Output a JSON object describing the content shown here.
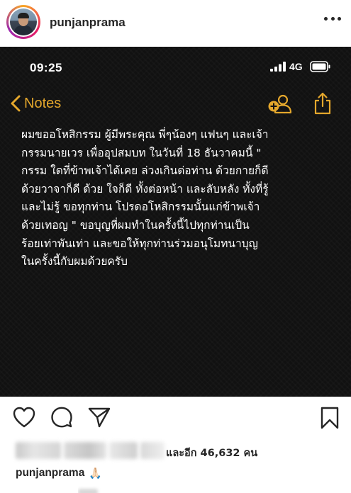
{
  "post": {
    "username": "punjanprama",
    "more_icon": "more-horizontal-icon"
  },
  "phone_screen": {
    "status_time": "09:25",
    "network": "4G",
    "back_label": "Notes",
    "accent_color": "#e4a72c",
    "note_lines": [
      "ผมขออโหสิกรรม ผู้มีพระคุณ พี่ๆน้องๆ แฟนๆ และเจ้า",
      "กรรมนายเวร เพื่ออุปสมบท ในวันที่ 18 ธันวาคมนี้ \"",
      "กรรม ใดที่ข้าพเจ้าได้เคย ล่วงเกินต่อท่าน ด้วยกายก็ดี",
      "ด้วยวาจาก็ดี ด้วย ใจก็ดี ทั้งต่อหน้า และลับหลัง ทั้งที่รู้",
      "และไม่รู้  ขอทุกท่าน โปรดอโหสิกรรมนั้นแก่ข้าพเจ้า",
      "ด้วยเทอญ  \" ขอบุญที่ผมทำในครั้งนี้ไปทุกท่านเป็น",
      "ร้อยเท่าพันเท่า และขอให้ทุกท่านร่วมอนุโมทนาบุญ",
      "ในครั้งนี้กับผมด้วยครับ"
    ]
  },
  "actions": {
    "like": "heart-icon",
    "comment": "comment-icon",
    "share": "send-icon",
    "save": "bookmark-icon"
  },
  "likes": {
    "text": "และอีก 46,632 คน"
  },
  "caption": {
    "username": "punjanprama",
    "emoji": "🙏🏻"
  }
}
